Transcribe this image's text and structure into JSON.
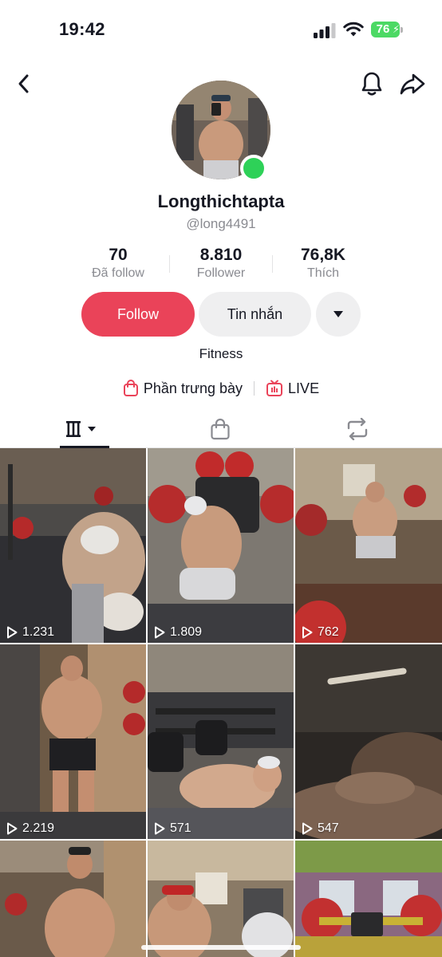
{
  "status_bar": {
    "time": "19:42",
    "battery": "76"
  },
  "profile": {
    "username": "Longthichtapta",
    "handle": "@long4491",
    "bio": "Fitness",
    "stats": [
      {
        "value": "70",
        "label": "Đã follow"
      },
      {
        "value": "8.810",
        "label": "Follower"
      },
      {
        "value": "76,8K",
        "label": "Thích"
      }
    ]
  },
  "actions": {
    "follow": "Follow",
    "message": "Tin nhắn"
  },
  "links": {
    "showcase": "Phần trưng bày",
    "live": "LIVE"
  },
  "colors": {
    "accent": "#ea4359",
    "online": "#2ed158",
    "live": "#ea4359"
  },
  "videos": [
    {
      "views": "1.231"
    },
    {
      "views": "1.809"
    },
    {
      "views": "762"
    },
    {
      "views": "2.219"
    },
    {
      "views": "571"
    },
    {
      "views": "547"
    },
    {
      "views": ""
    },
    {
      "views": ""
    },
    {
      "views": ""
    }
  ]
}
